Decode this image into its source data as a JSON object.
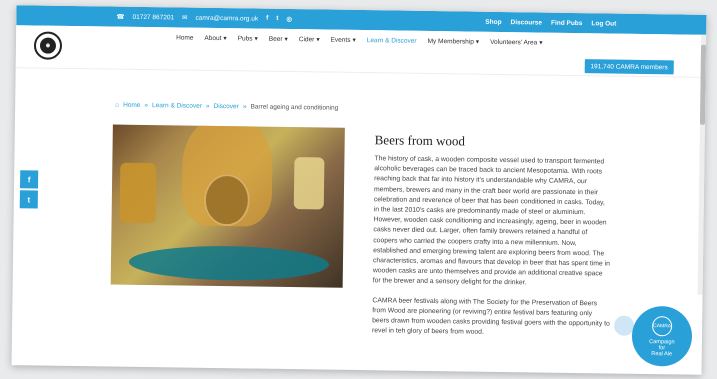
{
  "topbar": {
    "phone": "01727 867201",
    "email": "camra@camra.org.uk",
    "social_icons": [
      "facebook-icon",
      "twitter-icon",
      "instagram-icon"
    ],
    "links": [
      "Shop",
      "Discourse",
      "Find Pubs",
      "Log Out"
    ]
  },
  "nav": {
    "logo_text": "CAMRA",
    "items": [
      {
        "label": "Home",
        "dropdown": false
      },
      {
        "label": "About",
        "dropdown": true
      },
      {
        "label": "Pubs",
        "dropdown": true
      },
      {
        "label": "Beer",
        "dropdown": true
      },
      {
        "label": "Cider",
        "dropdown": true
      },
      {
        "label": "Events",
        "dropdown": true
      },
      {
        "label": "Learn & Discover",
        "dropdown": false,
        "active": true
      },
      {
        "label": "My Membership",
        "dropdown": true
      },
      {
        "label": "Volunteers' Area",
        "dropdown": true
      }
    ],
    "members_button": "191,740 CAMRA members"
  },
  "breadcrumb": {
    "home": "Home",
    "level1": "Learn & Discover",
    "level2": "Discover",
    "current": "Barrel ageing and conditioning",
    "separator": "»"
  },
  "article": {
    "title": "Beers from wood",
    "paragraphs": [
      "The history of cask, a wooden composite vessel used to transport fermented alcoholic beverages can be traced back to ancient Mesopotamia. With roots reaching back that far into history it's understandable why CAMRA, our members, brewers and many in the craft beer world are passionate in their celebration and reverence of beer that has been conditioned in casks. Today, in the last 2010's casks are predominantly made of steel or aluminium. However, wooden cask conditioning and increasingly, ageing, beer in wooden casks never died out. Larger, often family brewers retained a handful of coopers who carried the coopers crafty into a new millennium. Now, established and emerging brewing talent are exploring beers from wood. The characteristics, aromas and flavours that develop in beer that has spent time in wooden casks are unto themselves and provide an additional creative space for the brewer and a sensory delight for the drinker.",
      "CAMRA beer festivals along with The Society for the Preservation of Beers from Wood are pioneering (or reviving?) entire festival bars featuring only beers drawn from wooden casks providing festival goers with the opportunity to revel in teh glory of beers from wood."
    ]
  },
  "side_social": [
    "f",
    "t"
  ],
  "badge": {
    "logo_text": "CAMRA",
    "line1": "Campaign",
    "line2": "for",
    "line3": "Real Ale"
  },
  "colors": {
    "accent": "#2aa0d8"
  }
}
